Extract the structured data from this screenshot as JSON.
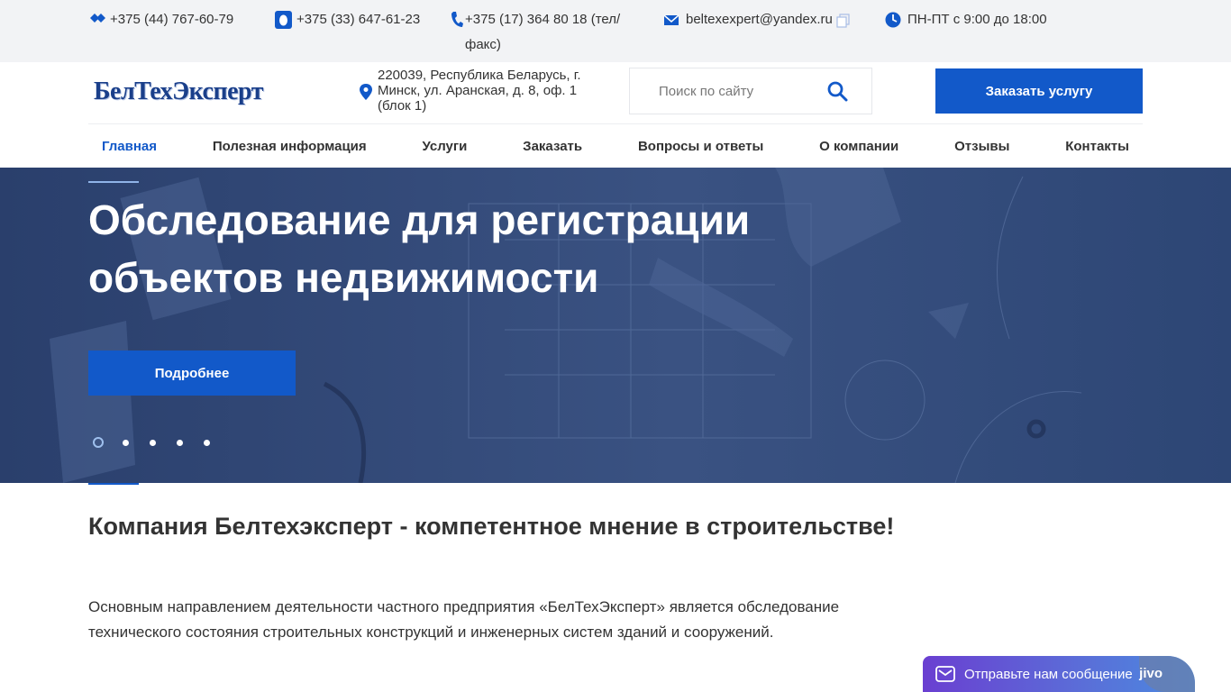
{
  "topbar": {
    "phone_a1": "+375 (44) 767-60-79",
    "phone_mts": "+375 (33) 647-61-23",
    "phone_city": "+375 (17) 364 80 18 (тел/факс)",
    "email": "beltexexpert@yandex.ru",
    "hours": "ПН-ПТ с 9:00 до 18:00"
  },
  "header": {
    "logo_text": "БелТехЭксперт",
    "address": "220039, Республика Беларусь, г. Минск, ул. Аранская, д. 8, оф. 1 (блок 1)",
    "search_placeholder": "Поиск по сайту",
    "order_label": "Заказать услугу"
  },
  "nav": {
    "items": [
      {
        "label": "Главная"
      },
      {
        "label": "Полезная информация"
      },
      {
        "label": "Услуги"
      },
      {
        "label": "Заказать"
      },
      {
        "label": "Вопросы и ответы"
      },
      {
        "label": "О компании"
      },
      {
        "label": "Отзывы"
      },
      {
        "label": "Контакты"
      }
    ]
  },
  "hero": {
    "title": "Обследование для регистрации объектов недвижимости",
    "button_label": "Подробнее",
    "slide_count": 5,
    "active_slide": 1
  },
  "content": {
    "title": "Компания Белтехэксперт - компетентное мнение в строительстве!",
    "text": "Основным направлением деятельности частного предприятия «БелТехЭксперт» является обследование технического состояния строительных конструкций и инженерных систем зданий и сооружений."
  },
  "chat": {
    "label": "Отправьте нам сообщение",
    "brand": "jivo"
  },
  "icons": {
    "phone_a1": "a1-logo-icon",
    "phone_mts": "mts-logo-icon",
    "phone_city": "phone-icon",
    "email": "mail-icon",
    "copy": "copy-icon",
    "hours": "clock-icon",
    "address": "map-pin-icon",
    "search": "search-icon"
  },
  "colors": {
    "accent": "#1259c9",
    "hero_overlay": "#2f4572",
    "topbar_bg": "#f2f3f5",
    "chat_start": "#6a3fd1",
    "chat_end": "#4a8ae0"
  }
}
